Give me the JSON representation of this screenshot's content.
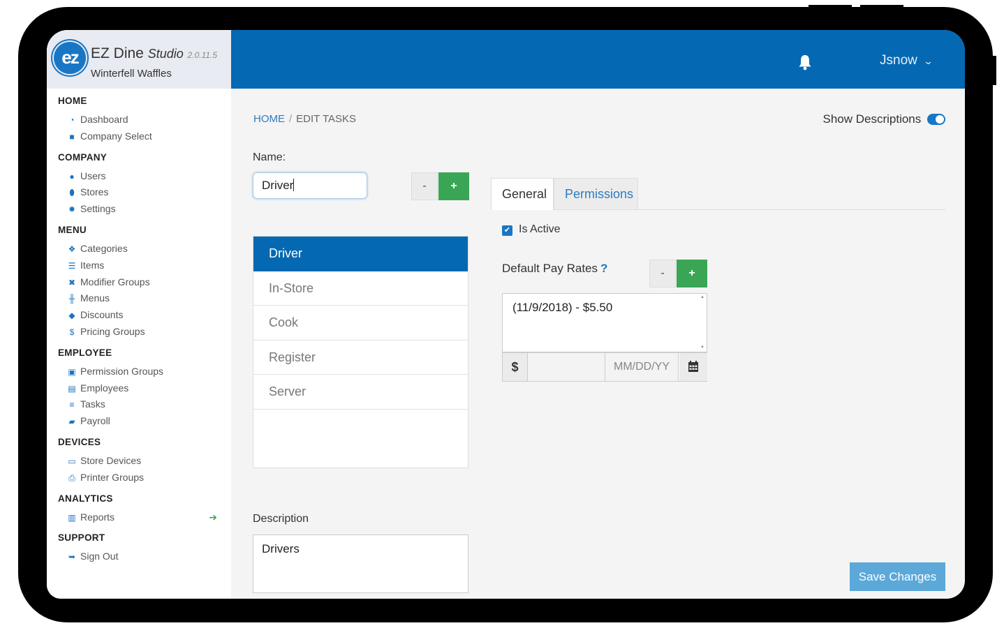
{
  "app": {
    "name": "EZ Dine",
    "product": "Studio",
    "version": "2.0.11.5",
    "store": "Winterfell Waffles",
    "logo_text": "ez"
  },
  "header": {
    "user": "Jsnow",
    "bell_icon": "bell-icon",
    "chevron_icon": "chevron-down-icon"
  },
  "nav": {
    "home": {
      "title": "HOME",
      "items": [
        {
          "label": "Dashboard",
          "icon": "dashboard-icon"
        },
        {
          "label": "Company Select",
          "icon": "briefcase-icon"
        }
      ]
    },
    "company": {
      "title": "COMPANY",
      "items": [
        {
          "label": "Users",
          "icon": "users-icon"
        },
        {
          "label": "Stores",
          "icon": "map-marker-icon"
        },
        {
          "label": "Settings",
          "icon": "gear-icon"
        }
      ]
    },
    "menu": {
      "title": "MENU",
      "items": [
        {
          "label": "Categories",
          "icon": "cubes-icon"
        },
        {
          "label": "Items",
          "icon": "list-icon"
        },
        {
          "label": "Modifier Groups",
          "icon": "modifier-icon"
        },
        {
          "label": "Menus",
          "icon": "utensils-icon"
        },
        {
          "label": "Discounts",
          "icon": "tags-icon"
        },
        {
          "label": "Pricing Groups",
          "icon": "dollar-icon"
        }
      ]
    },
    "employee": {
      "title": "EMPLOYEE",
      "items": [
        {
          "label": "Permission Groups",
          "icon": "permission-icon"
        },
        {
          "label": "Employees",
          "icon": "id-card-icon"
        },
        {
          "label": "Tasks",
          "icon": "tasks-icon"
        },
        {
          "label": "Payroll",
          "icon": "book-icon"
        }
      ]
    },
    "devices": {
      "title": "DEVICES",
      "items": [
        {
          "label": "Store Devices",
          "icon": "laptop-icon"
        },
        {
          "label": "Printer Groups",
          "icon": "printer-icon"
        }
      ]
    },
    "analytics": {
      "title": "ANALYTICS",
      "items": [
        {
          "label": "Reports",
          "icon": "bar-chart-icon"
        }
      ]
    },
    "support": {
      "title": "SUPPORT",
      "items": [
        {
          "label": "Sign Out",
          "icon": "sign-out-icon"
        }
      ]
    }
  },
  "breadcrumb": {
    "home": "HOME",
    "separator": "/",
    "current": "EDIT TASKS"
  },
  "show_descriptions": {
    "label": "Show Descriptions",
    "on": true
  },
  "form": {
    "name_label": "Name:",
    "name_value": "Driver",
    "minus": "-",
    "plus": "+",
    "tasks": [
      "Driver",
      "In-Store",
      "Cook",
      "Register",
      "Server"
    ],
    "selected_task": "Driver",
    "description_label": "Description",
    "description_value": "Drivers"
  },
  "tabs": {
    "general": "General",
    "permissions": "Permissions",
    "active": "General"
  },
  "general": {
    "is_active_label": "Is Active",
    "is_active": true,
    "pay_rates_label": "Default Pay Rates",
    "help": "?",
    "minus": "-",
    "plus": "+",
    "rates": [
      "(11/9/2018) - $5.50"
    ],
    "currency": "$",
    "date_placeholder": "MM/DD/YY"
  },
  "save_label": "Save Changes",
  "colors": {
    "brand_blue": "#0568b2",
    "green": "#3aa655",
    "save_blue": "#5ba8d9"
  }
}
